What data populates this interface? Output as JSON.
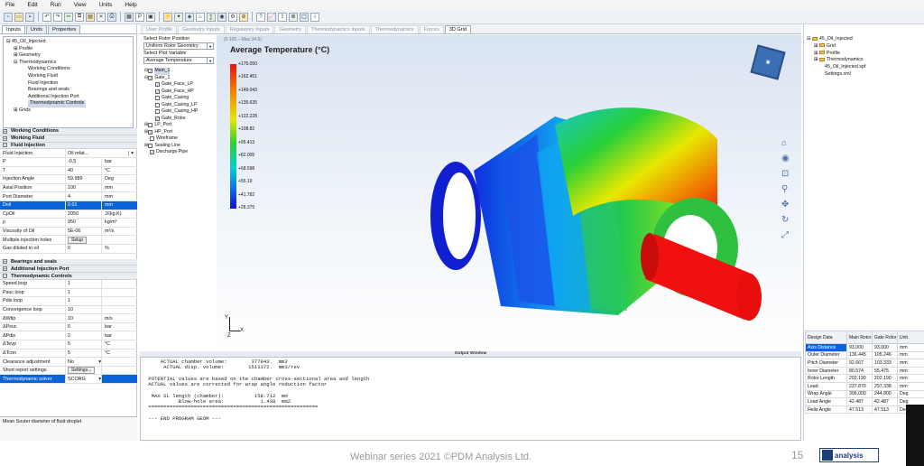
{
  "menu": [
    "File",
    "Edit",
    "Run",
    "View",
    "Units",
    "Help"
  ],
  "left": {
    "tabs": [
      "Inputs",
      "Units",
      "Properties"
    ],
    "tree": [
      "45_Oil_Injected",
      "Profile",
      "Geometry",
      "Thermodynamics",
      "Working Conditions",
      "Working Fluid",
      "Fluid Injection",
      "Bearings and seals",
      "Additional Injection Port",
      "Thermodynamic Controls",
      "Grids"
    ],
    "sec_working_conditions": "Working Conditions",
    "sec_working_fluid": "Working Fluid",
    "sec_fluid_injection": "Fluid Injection",
    "fluid_rows": [
      [
        "Fluid Injection",
        "Oil relat...",
        ""
      ],
      [
        "P",
        "-0.5",
        "bar"
      ],
      [
        "T",
        "40",
        "°C"
      ],
      [
        "Injection Angle",
        "59.989",
        "Deg"
      ],
      [
        "Axial Position",
        "100",
        "mm"
      ],
      [
        "Port Diameter",
        "4",
        "mm"
      ],
      [
        "Doil",
        "0.01",
        "mm"
      ],
      [
        "CpOil",
        "2050",
        "J/(kg.K)"
      ],
      [
        "ρ",
        "950",
        "kg/m³"
      ],
      [
        "Viscosity of Oil",
        "5E-06",
        "m²/s"
      ],
      [
        "Multiple injection holes",
        "Setup",
        ""
      ],
      [
        "Gas diluted in oil",
        "0",
        "%"
      ]
    ],
    "sec_bearings": "Bearings and seals",
    "sec_additional": "Additional Injection Port",
    "sec_thermo": "Thermodynamic Controls",
    "thermo_rows": [
      [
        "Speed loop",
        "1",
        ""
      ],
      [
        "Psuc loop",
        "1",
        ""
      ],
      [
        "Pdis loop",
        "1",
        ""
      ],
      [
        "Convergence loop",
        "10",
        ""
      ],
      [
        "ΔWtip",
        "10",
        "m/s"
      ],
      [
        "ΔPsuc",
        "0",
        "bar"
      ],
      [
        "ΔPdis",
        "2",
        "bar"
      ],
      [
        "ΔTevp",
        "5",
        "°C"
      ],
      [
        "ΔTcon",
        "5",
        "°C"
      ],
      [
        "Clearance adjustment",
        "No",
        ""
      ],
      [
        "Short report settings",
        "Settings...",
        ""
      ],
      [
        "Thermodynamic solver",
        "SCORG",
        ""
      ]
    ],
    "status": "Mean Souter diameter of fluid droplet"
  },
  "doc_tabs": [
    "User Profile",
    "Geometry Inputs",
    "Regulatory Inputs",
    "Geometry",
    "Thermodynamics Inputs",
    "Thermodynamics",
    "Forces",
    "3D Grid"
  ],
  "grid_panel": {
    "rotor_label": "Select Rotor Position",
    "rotor_value": "Uniform Rotor Geometry",
    "plot_label": "Select Plot Variable",
    "plot_value": "Average Temperature",
    "items": [
      "Main_1",
      "Gate_1",
      "Gate_Face_LP",
      "Gate_Face_HP",
      "Gate_Casing",
      "Gate_Casing_LP",
      "Gate_Casing_HP",
      "Gate_Rotor",
      "LP_Port",
      "HP_Port",
      "Wireframe",
      "Sealing Line",
      "Discharge Pipe"
    ]
  },
  "plot": {
    "title": "Average Temperature (°C)",
    "sub": "(0.165 – Max 34.6)",
    "ticks": [
      "+175.050",
      "+162.451",
      "+149.043",
      "+135.635",
      "+122.228",
      "+108.82",
      "+95.413",
      "+82.005",
      "+68.598",
      "+55.19",
      "+41.782",
      "+28.375"
    ]
  },
  "output_header": "Output Window",
  "output_text": "     ACTUAL chamber volume:        377843.  mm3\n      ACTUAL disp. volume:        1511372.  mm3/rev\n\n POTENTIAL values are based on the chamber cross-sectional area and length\n ACTUAL values are corrected for wrap angle reduction factor\n\n  MAX SL length (chamber):          158.712  mm\n           Blow-hole area:            1.438  mm2\n ========================================================\n\n --- END PROGRAM GEOM ---",
  "right": {
    "files": [
      "45_Oil_Injected",
      "Grid",
      "Profile",
      "Thermodynamics",
      "45_Oil_Injected.spf",
      "Settings.xml"
    ],
    "headers": [
      "Design Data",
      "Main Rotor",
      "Gate Rotor",
      "Unit"
    ],
    "rows": [
      [
        "Axis Distance",
        "93.000",
        "93.000",
        "mm"
      ],
      [
        "Outer Diameter",
        "136.445",
        "105.246",
        "mm"
      ],
      [
        "Pitch Diameter",
        "92.667",
        "103.333",
        "mm"
      ],
      [
        "Inner Diameter",
        "80.574",
        "55.475",
        "mm"
      ],
      [
        "Rotor Length",
        "202.190",
        "202.190",
        "mm"
      ],
      [
        "Lead",
        "237.870",
        "297.338",
        "mm"
      ],
      [
        "Wrap Angle",
        "306.000",
        "244.800",
        "Deg"
      ],
      [
        "Lead Angle",
        "42.487",
        "42.487",
        "Deg"
      ],
      [
        "Helix Angle",
        "47.513",
        "47.513",
        "Deg"
      ]
    ]
  },
  "footer": {
    "text": "Webinar series 2021 ©PDM Analysis Ltd.",
    "page": "15",
    "logo": "analysis"
  }
}
